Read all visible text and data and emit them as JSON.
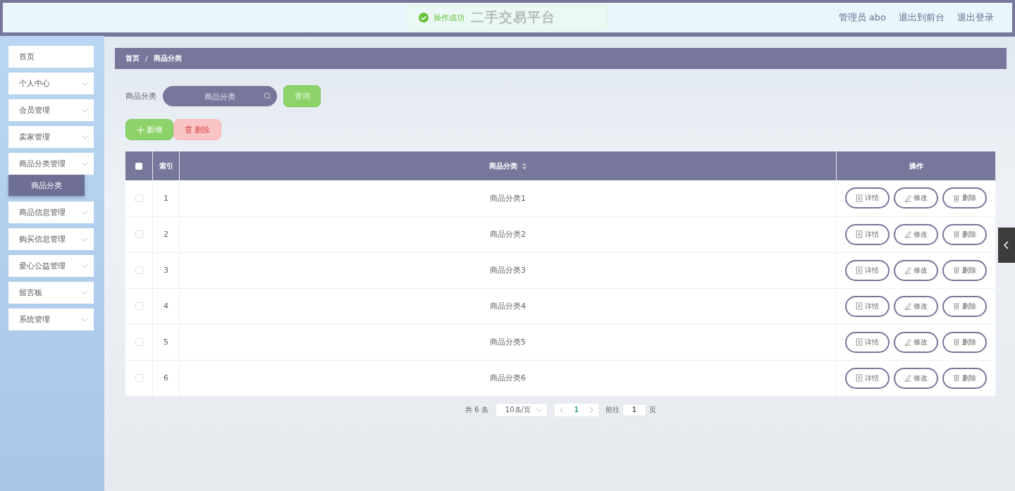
{
  "header": {
    "title": "二手交易平台",
    "links": [
      "管理员 abo",
      "退出到前台",
      "退出登录"
    ]
  },
  "toast": {
    "kind": "success",
    "message": "操作成功"
  },
  "sidebar": {
    "items": [
      {
        "label": "首页",
        "kind": "link"
      },
      {
        "label": "个人中心",
        "kind": "menu"
      },
      {
        "label": "会员管理",
        "kind": "menu"
      },
      {
        "label": "卖家管理",
        "kind": "menu"
      },
      {
        "label": "商品分类管理",
        "kind": "menu",
        "children": [
          {
            "label": "商品分类",
            "selected": true
          }
        ]
      },
      {
        "label": "商品信息管理",
        "kind": "menu"
      },
      {
        "label": "购买信息管理",
        "kind": "menu"
      },
      {
        "label": "爱心公益管理",
        "kind": "menu"
      },
      {
        "label": "留言板",
        "kind": "menu"
      },
      {
        "label": "系统管理",
        "kind": "menu"
      }
    ]
  },
  "breadcrumb": [
    "首页",
    "商品分类"
  ],
  "breadcrumb_separator": "/",
  "search": {
    "label": "商品分类",
    "placeholder": "商品分类",
    "button": "查询"
  },
  "actions": [
    {
      "kind": "add",
      "label": "新增",
      "disabled": false
    },
    {
      "kind": "delete",
      "label": "删除",
      "disabled": true
    }
  ],
  "table": {
    "columns": [
      {
        "kind": "checkbox",
        "checked": false
      },
      {
        "kind": "text",
        "label": "索引"
      },
      {
        "kind": "sort",
        "label": "商品分类"
      },
      {
        "kind": "text",
        "label": "操作"
      }
    ],
    "rows": [
      {
        "checked": false,
        "index": "1",
        "name": "商品分类1",
        "actions": [
          "详情",
          "修改",
          "删除"
        ]
      },
      {
        "checked": false,
        "index": "2",
        "name": "商品分类2",
        "actions": [
          "详情",
          "修改",
          "删除"
        ]
      },
      {
        "checked": false,
        "index": "3",
        "name": "商品分类3",
        "actions": [
          "详情",
          "修改",
          "删除"
        ]
      },
      {
        "checked": false,
        "index": "4",
        "name": "商品分类4",
        "actions": [
          "详情",
          "修改",
          "删除"
        ]
      },
      {
        "checked": false,
        "index": "5",
        "name": "商品分类5",
        "actions": [
          "详情",
          "修改",
          "删除"
        ]
      },
      {
        "checked": false,
        "index": "6",
        "name": "商品分类6",
        "actions": [
          "详情",
          "修改",
          "删除"
        ]
      }
    ]
  },
  "pagination": {
    "total": "共 6 条",
    "page_size": "10条/页",
    "pages": [
      {
        "label": "1",
        "selected": true
      }
    ],
    "goto_label": "前往",
    "goto_value": "1",
    "goto_suffix": "页"
  }
}
